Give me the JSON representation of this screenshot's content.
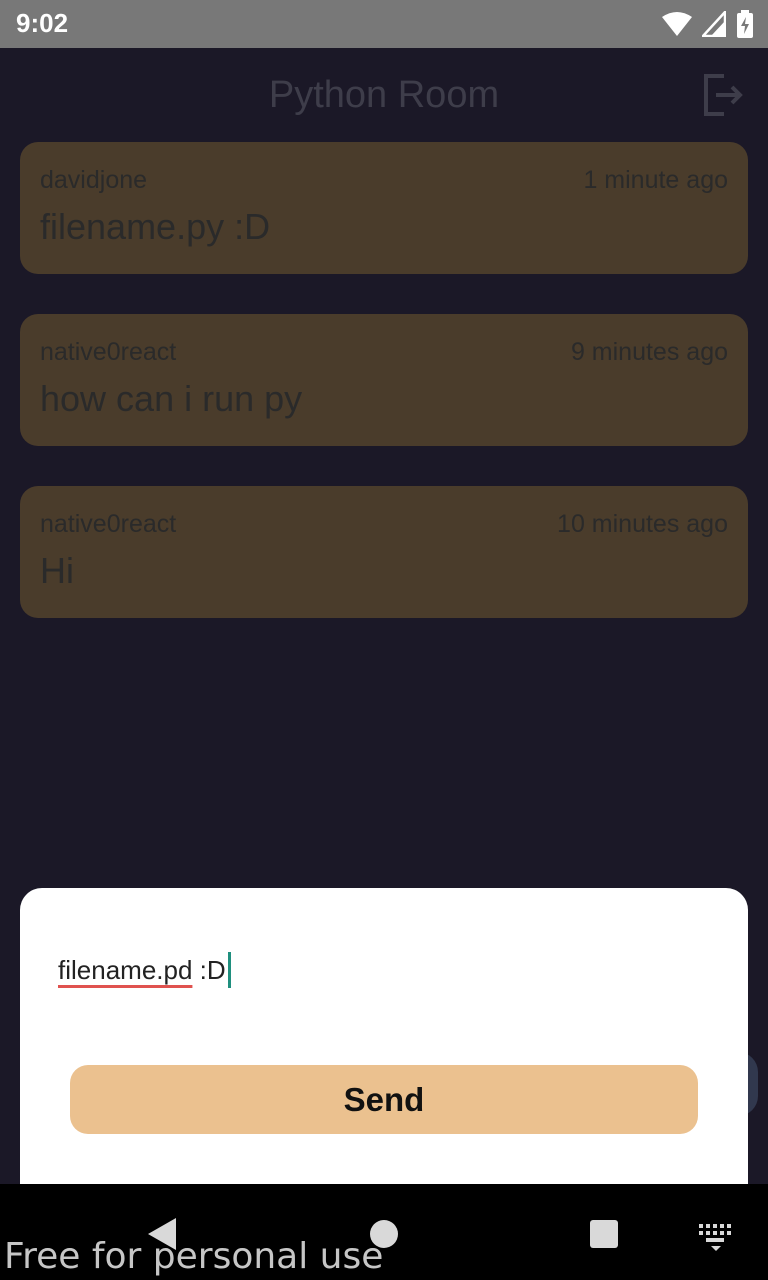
{
  "status_bar": {
    "time": "9:02"
  },
  "header": {
    "title": "Python Room",
    "logout_icon": "logout-icon"
  },
  "messages": [
    {
      "user": "davidjone",
      "time": "1 minute ago",
      "text": "filename.py :D"
    },
    {
      "user": "native0react",
      "time": "9 minutes ago",
      "text": "how can i run py"
    },
    {
      "user": "native0react",
      "time": "10 minutes ago",
      "text": "Hi"
    }
  ],
  "composer": {
    "misspelled_word": "filename.pd",
    "rest_text": " :D",
    "send_label": "Send"
  },
  "nav_bar": {
    "icons": [
      "back-icon",
      "home-icon",
      "recents-icon",
      "keyboard-icon"
    ]
  },
  "watermark": "Free for personal use",
  "colors": {
    "background": "#1b1827",
    "card": "#4a3c2b",
    "send_button": "#ebc18f",
    "caret": "#1f8f7e"
  }
}
